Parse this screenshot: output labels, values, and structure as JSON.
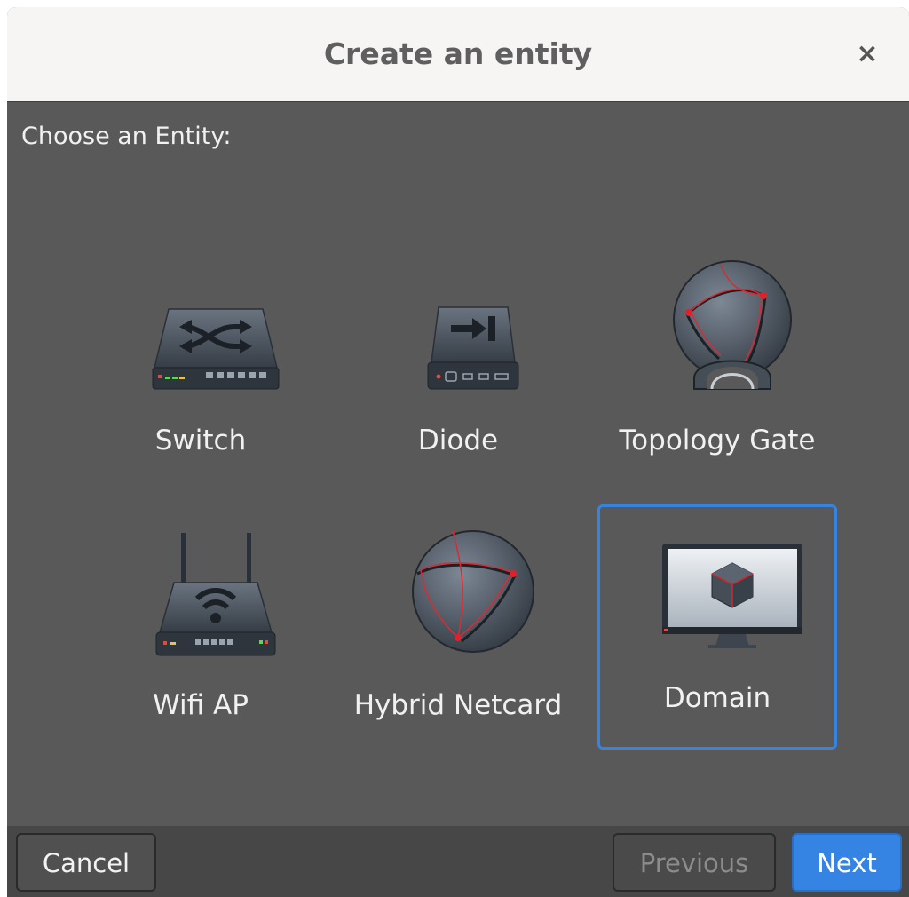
{
  "dialog": {
    "title": "Create an entity",
    "close_label": "×"
  },
  "prompt": "Choose an Entity:",
  "entities": [
    {
      "label": "Switch",
      "icon": "switch-icon"
    },
    {
      "label": "Diode",
      "icon": "diode-icon"
    },
    {
      "label": "Topology Gate",
      "icon": "topology-gate-icon"
    },
    {
      "label": "Wifi AP",
      "icon": "wifi-ap-icon"
    },
    {
      "label": "Hybrid Netcard",
      "icon": "hybrid-netcard-icon"
    },
    {
      "label": "Domain",
      "icon": "domain-icon",
      "selected": true
    }
  ],
  "footer": {
    "cancel_label": "Cancel",
    "previous_label": "Previous",
    "next_label": "Next"
  },
  "colors": {
    "accent": "#3584e4",
    "background": "#595959",
    "titlebar": "#f6f5f4",
    "icon_red": "#e0202a"
  }
}
